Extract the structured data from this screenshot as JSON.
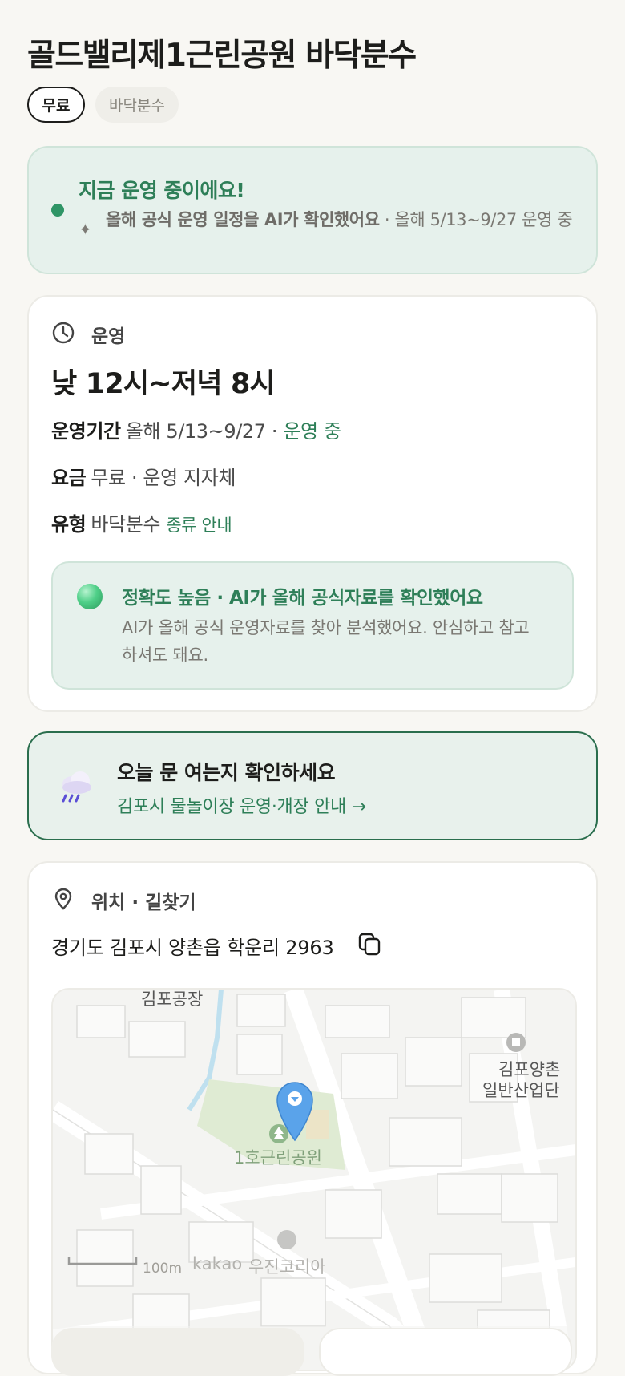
{
  "header": {
    "title": "골드밸리제1근린공원 바닥분수",
    "chips": {
      "fee": "무료",
      "type": "바닥분수"
    }
  },
  "status": {
    "headline": "지금 운영 중이에요!",
    "note_bold": "올해 공식 운영 일정을 AI가 확인했어요",
    "note_rest": " · 올해 5/13~9/27 운영 중"
  },
  "operation": {
    "section_label": "운영",
    "hours": "낮 12시~저녁 8시",
    "period": {
      "label": "운영기간",
      "value": "올해 5/13~9/27 · ",
      "status": "운영 중"
    },
    "fee": {
      "label": "요금",
      "value": "무료 · 운영 지자체"
    },
    "type": {
      "label": "유형",
      "value": "바닥분수 ",
      "link": "종류 안내"
    },
    "accuracy": {
      "headline": "정확도 높음 · AI가 올해 공식자료를 확인했어요",
      "body": "AI가 올해 공식 운영자료를 찾아 분석했어요. 안심하고 참고하셔도 돼요."
    }
  },
  "promo": {
    "headline": "오늘 문 여는지 확인하세요",
    "link": "김포시 물놀이장 운영·개장 안내 →"
  },
  "location": {
    "section_label": "위치 · 길찾기",
    "address": "경기도 김포시 양촌읍 학운리 2963",
    "map": {
      "labels": {
        "factory": "김포공장",
        "park": "1호근린공원",
        "industrial_1": "김포양촌",
        "industrial_2": "일반산업단",
        "company": "우진코리아",
        "scale": "100m",
        "brand": "kakao"
      }
    }
  },
  "colors": {
    "accent_green": "#2e7f58",
    "status_bg": "#e6f1ec",
    "pin_blue": "#5aa3ea",
    "page_bg": "#f8f7f3"
  }
}
